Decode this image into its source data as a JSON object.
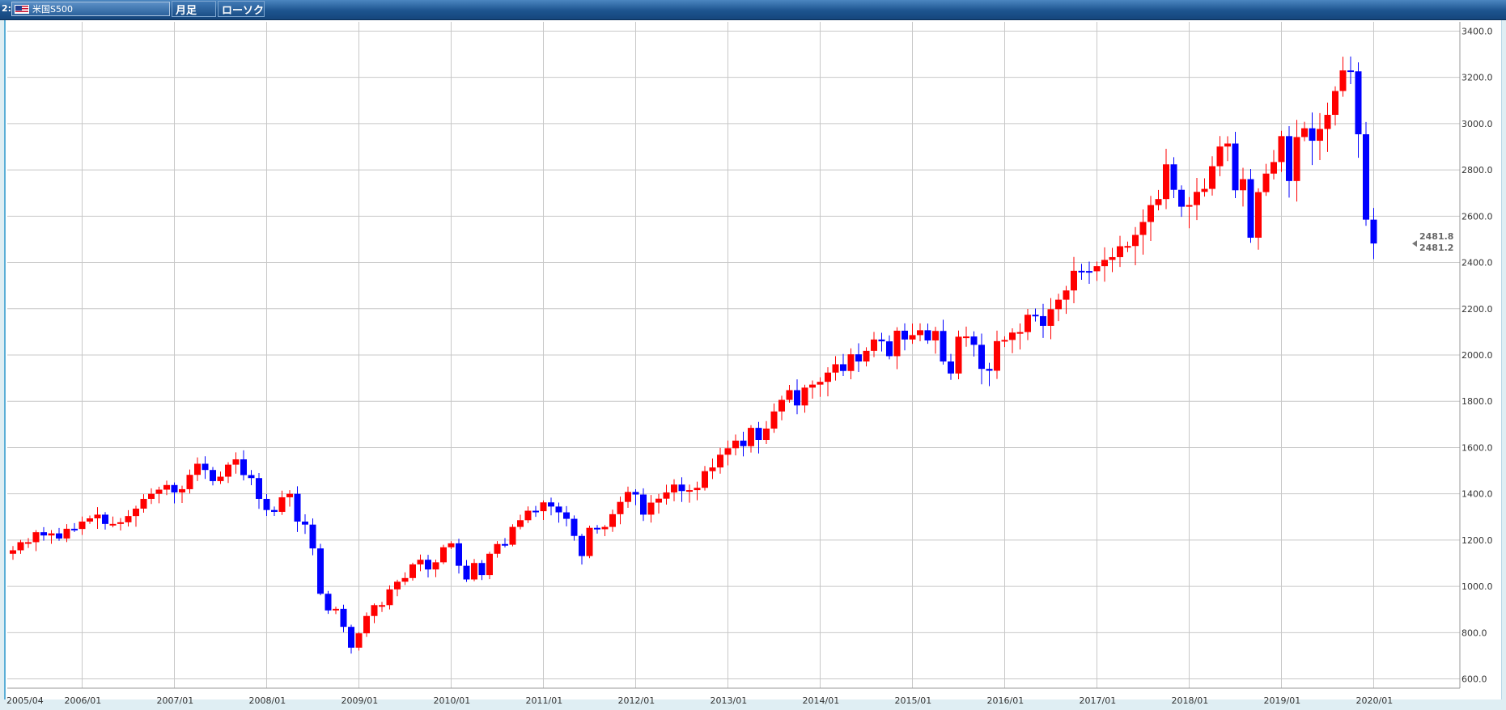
{
  "header": {
    "pane_number": "2:",
    "symbol_name": "米国S500",
    "flag_icon": "us-flag-icon",
    "period_label": "月足",
    "chart_style_label": "ローソク"
  },
  "colors": {
    "up": "#ff0000",
    "down": "#0000ff",
    "grid": "#c8c8c8",
    "header_bar": "#1d548f"
  },
  "chart_data": {
    "type": "candlestick",
    "timeframe": "monthly",
    "y_axis_position": "right",
    "ylim": [
      560,
      3440
    ],
    "yticks": [
      600,
      800,
      1000,
      1200,
      1400,
      1600,
      1800,
      2000,
      2200,
      2400,
      2600,
      2800,
      3000,
      3200,
      3400
    ],
    "ytick_labels": [
      "600.0",
      "800.0",
      "1000.0",
      "1200.0",
      "1400.0",
      "1600.0",
      "1800.0",
      "2000.0",
      "2200.0",
      "2400.0",
      "2600.0",
      "2800.0",
      "3000.0",
      "3200.0",
      "3400.0"
    ],
    "xtick_labels": [
      "2005/04",
      "2006/01",
      "2007/01",
      "2008/01",
      "2009/01",
      "2010/01",
      "2011/01",
      "2012/01",
      "2013/01",
      "2014/01",
      "2015/01",
      "2016/01",
      "2017/01",
      "2018/01",
      "2019/01",
      "2020/01"
    ],
    "xtick_index": [
      0,
      9,
      21,
      33,
      45,
      57,
      69,
      81,
      93,
      105,
      117,
      129,
      141,
      153,
      165,
      177
    ],
    "grid": true,
    "last_price_labels": [
      "2481.8",
      "2481.2"
    ],
    "last_price_value": 2481.5,
    "closes": [
      1156,
      1191,
      1191,
      1234,
      1220,
      1229,
      1207,
      1249,
      1248,
      1280,
      1294,
      1310,
      1270,
      1270,
      1277,
      1304,
      1336,
      1378,
      1400,
      1418,
      1438,
      1406,
      1420,
      1482,
      1530,
      1503,
      1455,
      1474,
      1526,
      1549,
      1481,
      1468,
      1378,
      1330,
      1322,
      1385,
      1400,
      1280,
      1267,
      1164,
      968,
      896,
      903,
      825,
      735,
      797,
      872,
      919,
      919,
      987,
      1020,
      1036,
      1095,
      1115,
      1073,
      1104,
      1169,
      1186,
      1089,
      1030,
      1101,
      1049,
      1141,
      1183,
      1180,
      1257,
      1286,
      1327,
      1325,
      1363,
      1345,
      1320,
      1292,
      1218,
      1131,
      1253,
      1247,
      1257,
      1312,
      1365,
      1408,
      1397,
      1310,
      1362,
      1379,
      1406,
      1440,
      1412,
      1416,
      1426,
      1498,
      1514,
      1569,
      1597,
      1630,
      1606,
      1685,
      1633,
      1682,
      1756,
      1806,
      1848,
      1782,
      1859,
      1872,
      1884,
      1924,
      1960,
      1931,
      2003,
      1972,
      2018,
      2067,
      2059,
      1995,
      2105,
      2067,
      2086,
      2107,
      2063,
      2104,
      1972,
      1920,
      2079,
      2080,
      2044,
      1940,
      1932,
      2060,
      2065,
      2097,
      2099,
      2174,
      2168,
      2126,
      2198,
      2239,
      2279,
      2364,
      2363,
      2362,
      2384,
      2411,
      2423,
      2470,
      2471,
      2519,
      2575,
      2648,
      2674,
      2824,
      2714,
      2641,
      2648,
      2705,
      2718,
      2816,
      2901,
      2914,
      2712,
      2760,
      2507,
      2704,
      2784,
      2834,
      2946,
      2752,
      2942,
      2980,
      2926,
      2977,
      3038,
      3141,
      3230,
      3226,
      2954,
      2585,
      2482
    ]
  }
}
